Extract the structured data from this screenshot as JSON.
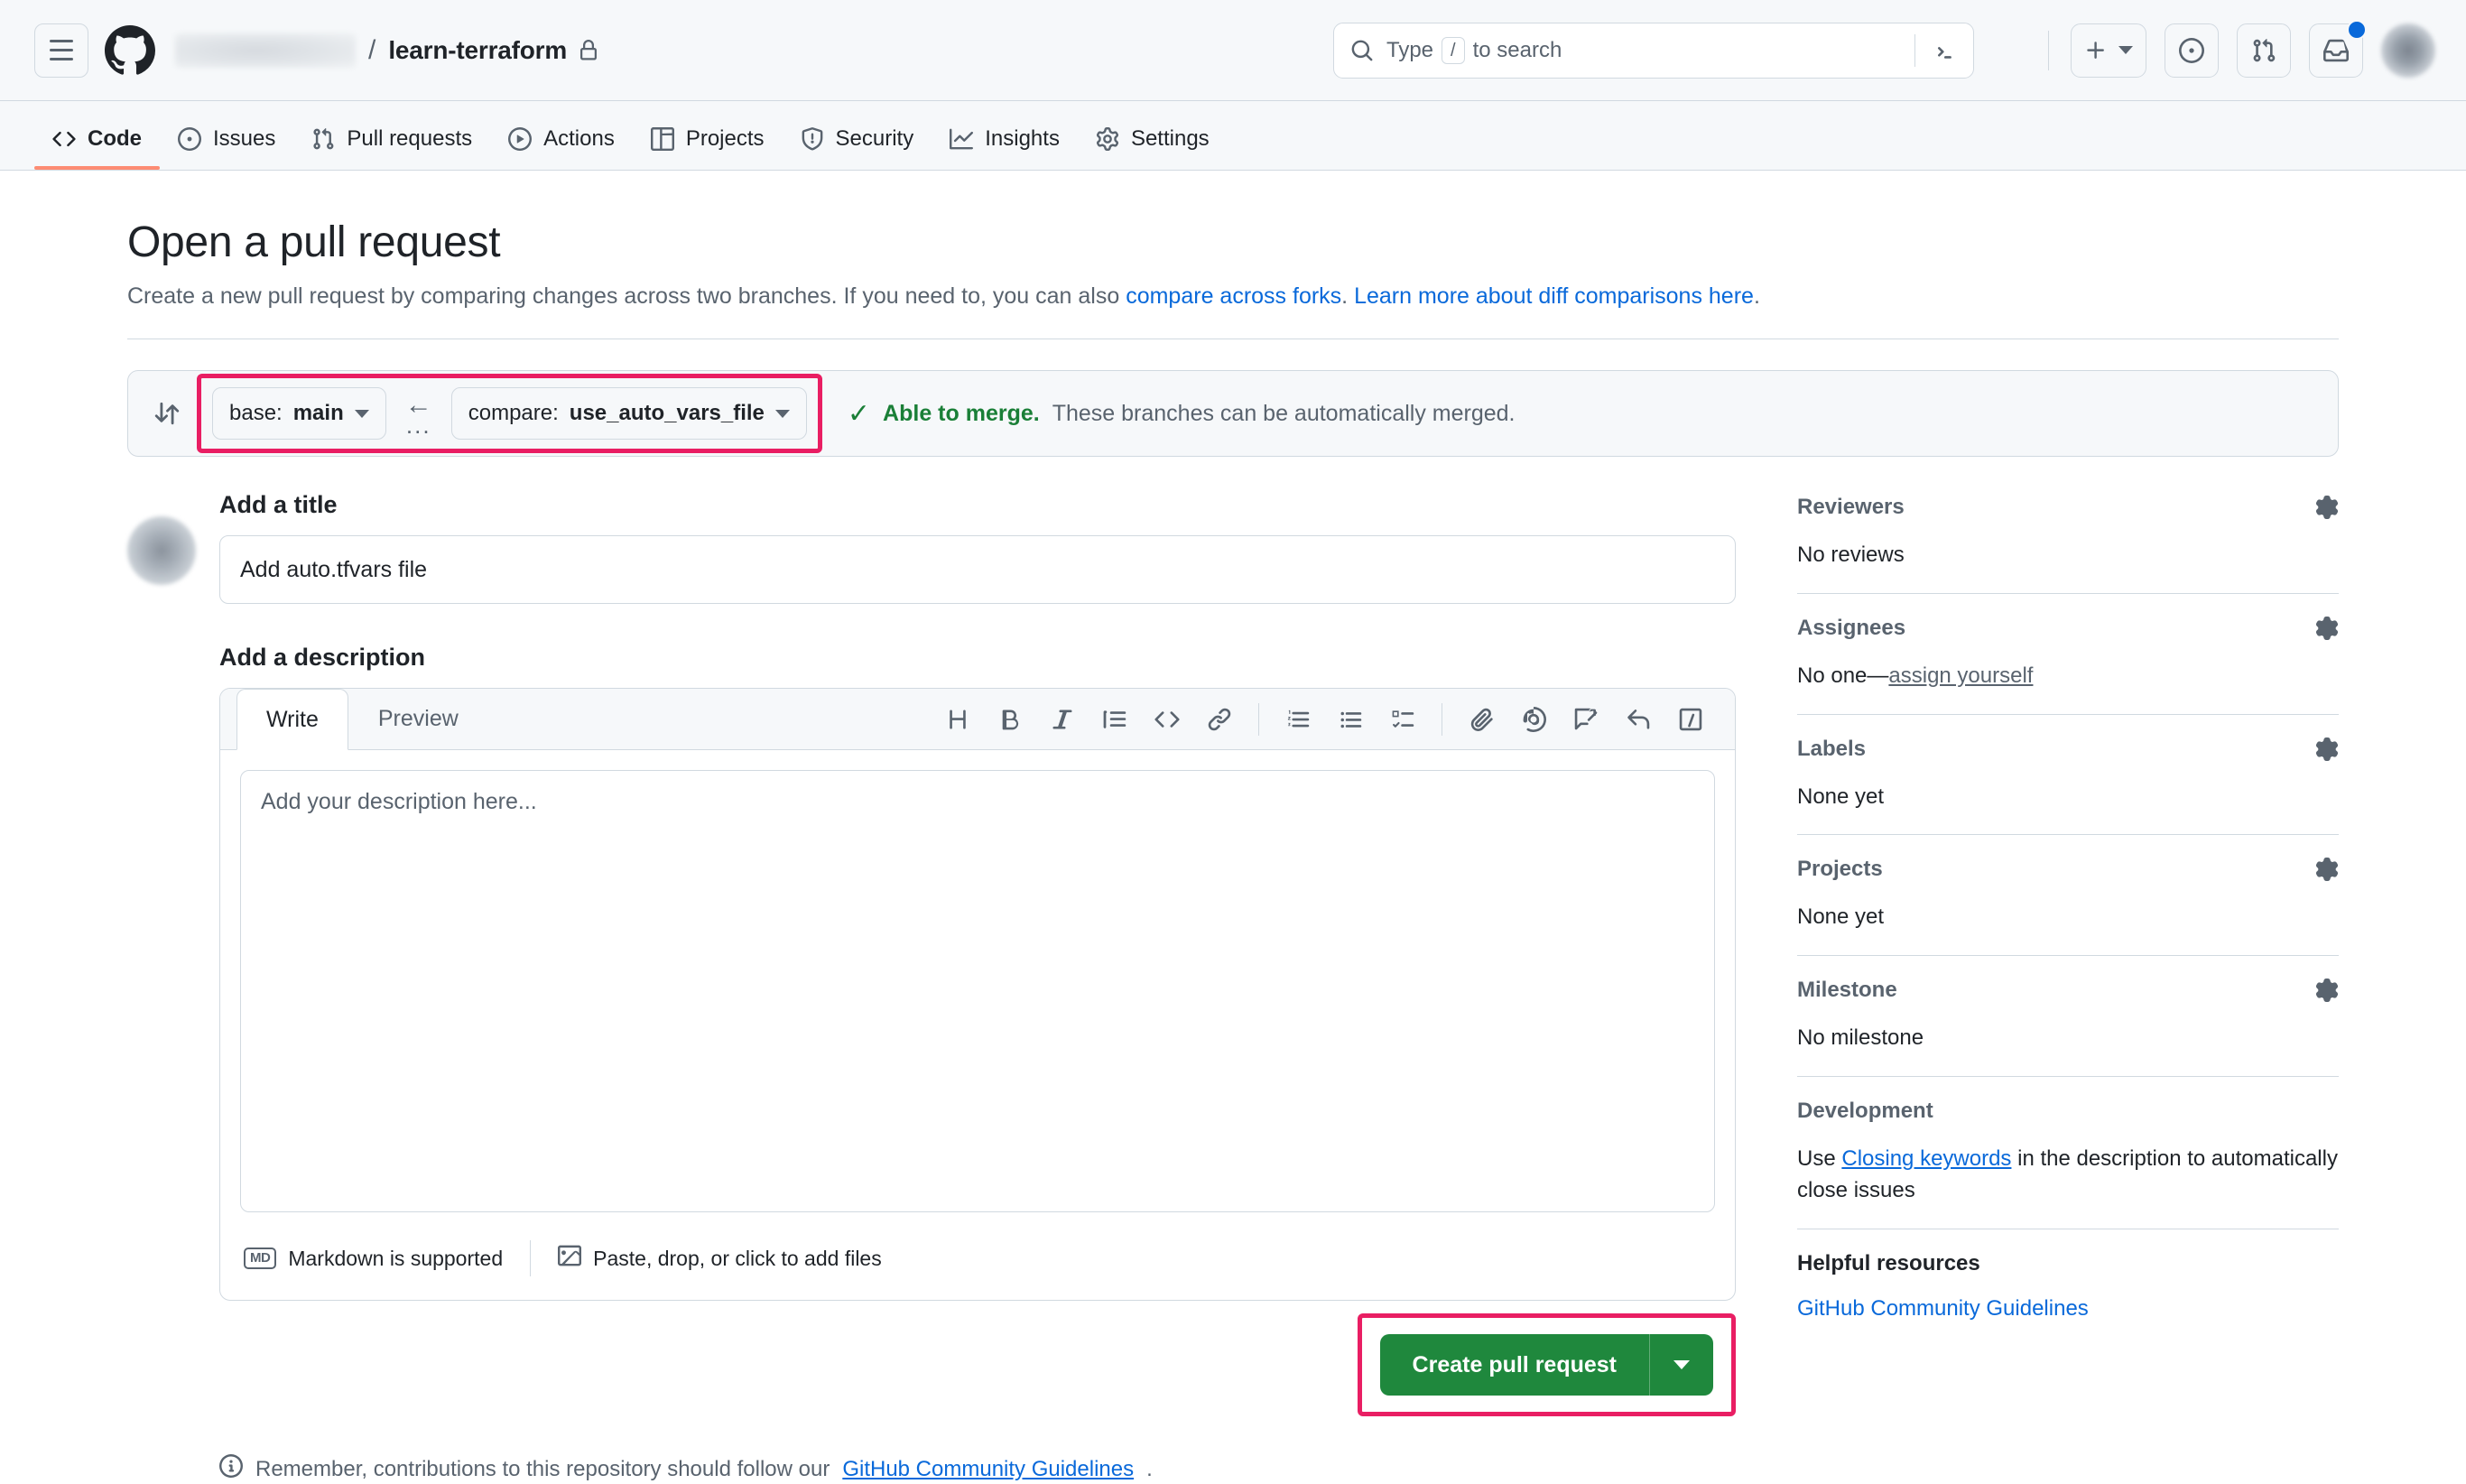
{
  "header": {
    "owner_redacted": "",
    "separator": "/",
    "repo_name": "learn-terraform",
    "search_placeholder": "Type",
    "search_kbd": "/",
    "search_suffix": "to search",
    "icons": {
      "hamburger": "hamburger-menu-icon",
      "logo": "github-logo-icon",
      "lock": "lock-icon",
      "search": "search-icon",
      "terminal": "terminal-icon",
      "plus": "plus-icon",
      "issues": "issue-opened-icon",
      "pull_requests": "git-pull-request-icon",
      "inbox": "inbox-icon",
      "avatar": "avatar"
    }
  },
  "repo_nav": {
    "tabs": [
      {
        "label": "Code",
        "icon": "code-icon",
        "active": true
      },
      {
        "label": "Issues",
        "icon": "issue-opened-icon",
        "active": false
      },
      {
        "label": "Pull requests",
        "icon": "git-pull-request-icon",
        "active": false
      },
      {
        "label": "Actions",
        "icon": "play-icon",
        "active": false
      },
      {
        "label": "Projects",
        "icon": "table-icon",
        "active": false
      },
      {
        "label": "Security",
        "icon": "shield-icon",
        "active": false
      },
      {
        "label": "Insights",
        "icon": "graph-icon",
        "active": false
      },
      {
        "label": "Settings",
        "icon": "gear-icon",
        "active": false
      }
    ]
  },
  "main": {
    "title": "Open a pull request",
    "subtitle_prefix": "Create a new pull request by comparing changes across two branches. If you need to, you can also ",
    "subtitle_link1": "compare across forks",
    "subtitle_middle": ". ",
    "subtitle_link2": "Learn more about diff comparisons here",
    "subtitle_suffix": ".",
    "compare": {
      "base_label": "base:",
      "base_value": "main",
      "compare_label": "compare:",
      "compare_value": "use_auto_vars_file",
      "arrow": "←",
      "dots": "...",
      "status_check": "✓",
      "status_bold": "Able to merge.",
      "status_note": "These branches can be automatically merged."
    },
    "title_section_label": "Add a title",
    "title_value": "Add auto.tfvars file",
    "description_section_label": "Add a description",
    "editor": {
      "tab_write": "Write",
      "tab_preview": "Preview",
      "placeholder": "Add your description here...",
      "tools": [
        "heading-icon",
        "bold-icon",
        "italic-icon",
        "quote-icon",
        "code-icon",
        "link-icon",
        "numbered-list-icon",
        "bulleted-list-icon",
        "task-list-icon",
        "attach-file-icon",
        "mention-icon",
        "saved-reply-icon",
        "reply-icon",
        "slash-command-icon"
      ],
      "footer_markdown": "Markdown is supported",
      "footer_markdown_badge": "MD",
      "footer_files": "Paste, drop, or click to add files"
    },
    "submit_label": "Create pull request",
    "note_prefix": "Remember, contributions to this repository should follow our ",
    "note_link": "GitHub Community Guidelines",
    "note_suffix": "."
  },
  "sidebar": {
    "reviewers": {
      "title": "Reviewers",
      "value": "No reviews"
    },
    "assignees": {
      "title": "Assignees",
      "value_prefix": "No one—",
      "value_link": "assign yourself"
    },
    "labels": {
      "title": "Labels",
      "value": "None yet"
    },
    "projects": {
      "title": "Projects",
      "value": "None yet"
    },
    "milestone": {
      "title": "Milestone",
      "value": "No milestone"
    },
    "development": {
      "title": "Development",
      "text_prefix": "Use ",
      "link": "Closing keywords",
      "text_suffix": " in the description to automatically close issues"
    },
    "helpful": {
      "title": "Helpful resources",
      "link": "GitHub Community Guidelines"
    }
  },
  "colors": {
    "accent_blue": "#0969da",
    "success_green": "#1a7f37",
    "button_green": "#1f883d",
    "annotation_pink": "#e91e63",
    "active_tab_orange": "#fd8c73"
  }
}
